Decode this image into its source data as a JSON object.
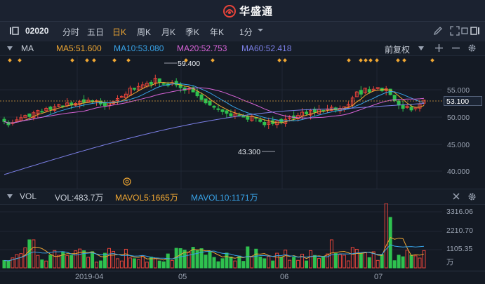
{
  "app": {
    "brand": "华盛通"
  },
  "toolbar": {
    "code": "02020",
    "periods": [
      "分时",
      "五日",
      "日K",
      "周K",
      "月K",
      "季K",
      "年K"
    ],
    "active_period": "日K",
    "interval": "1分",
    "icons": [
      "sidebar-toggle-icon",
      "pencil-icon",
      "expand-icon",
      "restore-icon",
      "settings-icon"
    ]
  },
  "ma_bar": {
    "label": "MA",
    "ma5": "MA5:51.600",
    "ma10": "MA10:53.080",
    "ma20": "MA20:52.753",
    "ma60": "MA60:52.418",
    "adjust": "前复权",
    "colors": {
      "ma5": "#f0a732",
      "ma10": "#38a3e8",
      "ma20": "#d763d7",
      "ma60": "#7b7fe6"
    }
  },
  "price_axis": {
    "ticks": [
      "55.000",
      "50.000",
      "45.000",
      "40.000"
    ],
    "current_tag": "53.100"
  },
  "annotations": {
    "high": "59.400",
    "low": "43.300"
  },
  "vol_bar": {
    "label": "VOL",
    "vol": "VOL:483.7万",
    "mavol5": "MAVOL5:1665万",
    "mavol10": "MAVOL10:1171万",
    "colors": {
      "vol": "#c8ced8",
      "mavol5": "#f0a732",
      "mavol10": "#38a3e8"
    }
  },
  "vol_axis": {
    "ticks": [
      "3316.06",
      "2210.70",
      "1105.35"
    ],
    "unit": "万"
  },
  "x_axis": {
    "labels": [
      "2019-04",
      "05",
      "06",
      "07"
    ]
  },
  "colors": {
    "up": "#e8443a",
    "down": "#2fc14f",
    "background": "#141a24"
  }
}
